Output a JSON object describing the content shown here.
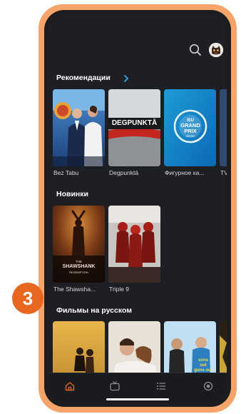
{
  "sections": [
    {
      "title": "Рекомендации",
      "cards": [
        {
          "caption": "Bez Tabu"
        },
        {
          "caption": "Degpunktā",
          "poster_text": "DEGPUNKTĀ"
        },
        {
          "caption": "Фигурное ка..."
        },
        {
          "caption": "TV"
        }
      ]
    },
    {
      "title": "Новинки",
      "cards": [
        {
          "caption": "The Shawsha...",
          "poster_text_1": "THE",
          "poster_text_2": "SHAWSHANK",
          "poster_text_3": "REDEMPTION"
        },
        {
          "caption": "Triple 9"
        }
      ]
    },
    {
      "title": "Фильмы на русском",
      "cards": [
        {
          "caption": ""
        },
        {
          "caption": ""
        },
        {
          "caption": "",
          "poster_text_1": "sons",
          "poster_text_2": "out",
          "poster_text_3": "guns out"
        },
        {
          "caption": ""
        }
      ]
    }
  ],
  "badge": {
    "number": "3"
  },
  "colors": {
    "frame": "#f7a46a",
    "accent": "#e8661f",
    "chevron": "#2ea8e6",
    "background": "#1e1f24"
  },
  "icons": [
    "search-icon",
    "avatar-icon",
    "chevron-right-icon",
    "home-icon",
    "tv-icon",
    "list-icon",
    "record-icon"
  ],
  "nav": {
    "active": "home"
  }
}
